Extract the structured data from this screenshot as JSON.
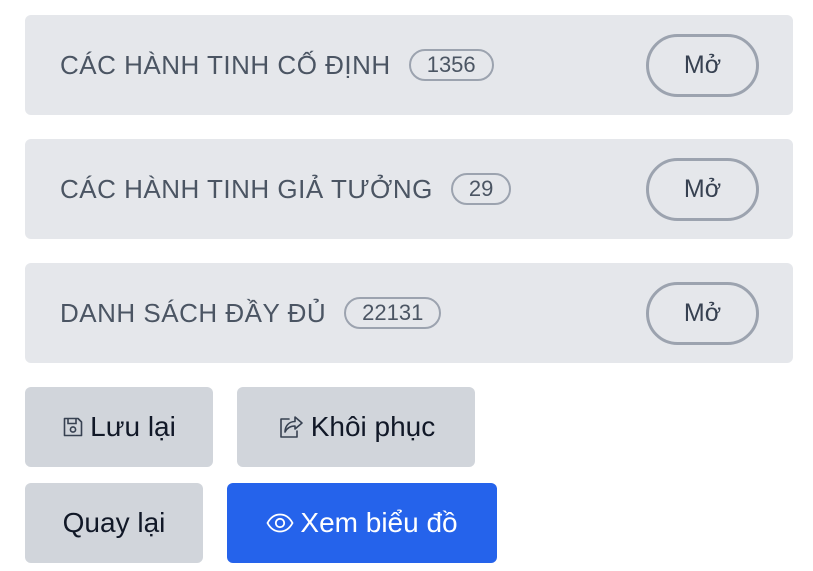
{
  "panels": [
    {
      "title": "CÁC HÀNH TINH CỐ ĐỊNH",
      "count": "1356",
      "button_label": "Mở"
    },
    {
      "title": "CÁC HÀNH TINH GIẢ TƯỞNG",
      "count": "29",
      "button_label": "Mở"
    },
    {
      "title": "DANH SÁCH ĐẦY ĐỦ",
      "count": "22131",
      "button_label": "Mở"
    }
  ],
  "actions": {
    "save_label": "Lưu lại",
    "restore_label": "Khôi phục",
    "back_label": "Quay lại",
    "view_chart_label": "Xem biểu đồ",
    "save_icon": "save-icon",
    "restore_icon": "share-icon",
    "view_icon": "eye-icon"
  },
  "colors": {
    "panel_bg": "#e5e7eb",
    "secondary_button": "#d1d5db",
    "primary_button": "#2563eb"
  }
}
